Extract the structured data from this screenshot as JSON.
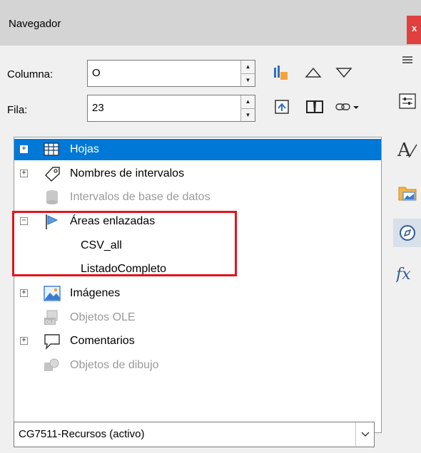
{
  "window": {
    "title": "Navegador",
    "close_label": "x"
  },
  "column": {
    "label": "Columna:",
    "value": "O"
  },
  "row": {
    "label": "Fila:",
    "value": "23"
  },
  "tree": [
    {
      "label": "Hojas",
      "expander": "+",
      "icon": "sheet-grid-icon",
      "selected": true,
      "disabled": false
    },
    {
      "label": "Nombres de intervalos",
      "expander": "+",
      "icon": "tag-icon",
      "selected": false,
      "disabled": false
    },
    {
      "label": "Intervalos de base de datos",
      "expander": "",
      "icon": "database-icon",
      "selected": false,
      "disabled": true
    },
    {
      "label": "Áreas enlazadas",
      "expander": "−",
      "icon": "flag-icon",
      "selected": false,
      "disabled": false
    },
    {
      "label": "CSV_all",
      "child": true
    },
    {
      "label": "ListadoCompleto",
      "child": true
    },
    {
      "label": "Imágenes",
      "expander": "+",
      "icon": "image-icon",
      "selected": false,
      "disabled": false
    },
    {
      "label": "Objetos OLE",
      "expander": "",
      "icon": "ole-object-icon",
      "selected": false,
      "disabled": true
    },
    {
      "label": "Comentarios",
      "expander": "+",
      "icon": "comment-icon",
      "selected": false,
      "disabled": false
    },
    {
      "label": "Objetos de dibujo",
      "expander": "",
      "icon": "drawing-object-icon",
      "selected": false,
      "disabled": true
    }
  ],
  "document_select": {
    "value": "CG7511-Recursos (activo)"
  },
  "colors": {
    "selection": "#0078d7",
    "highlight_box": "#e4141c",
    "close": "#e0403e"
  }
}
